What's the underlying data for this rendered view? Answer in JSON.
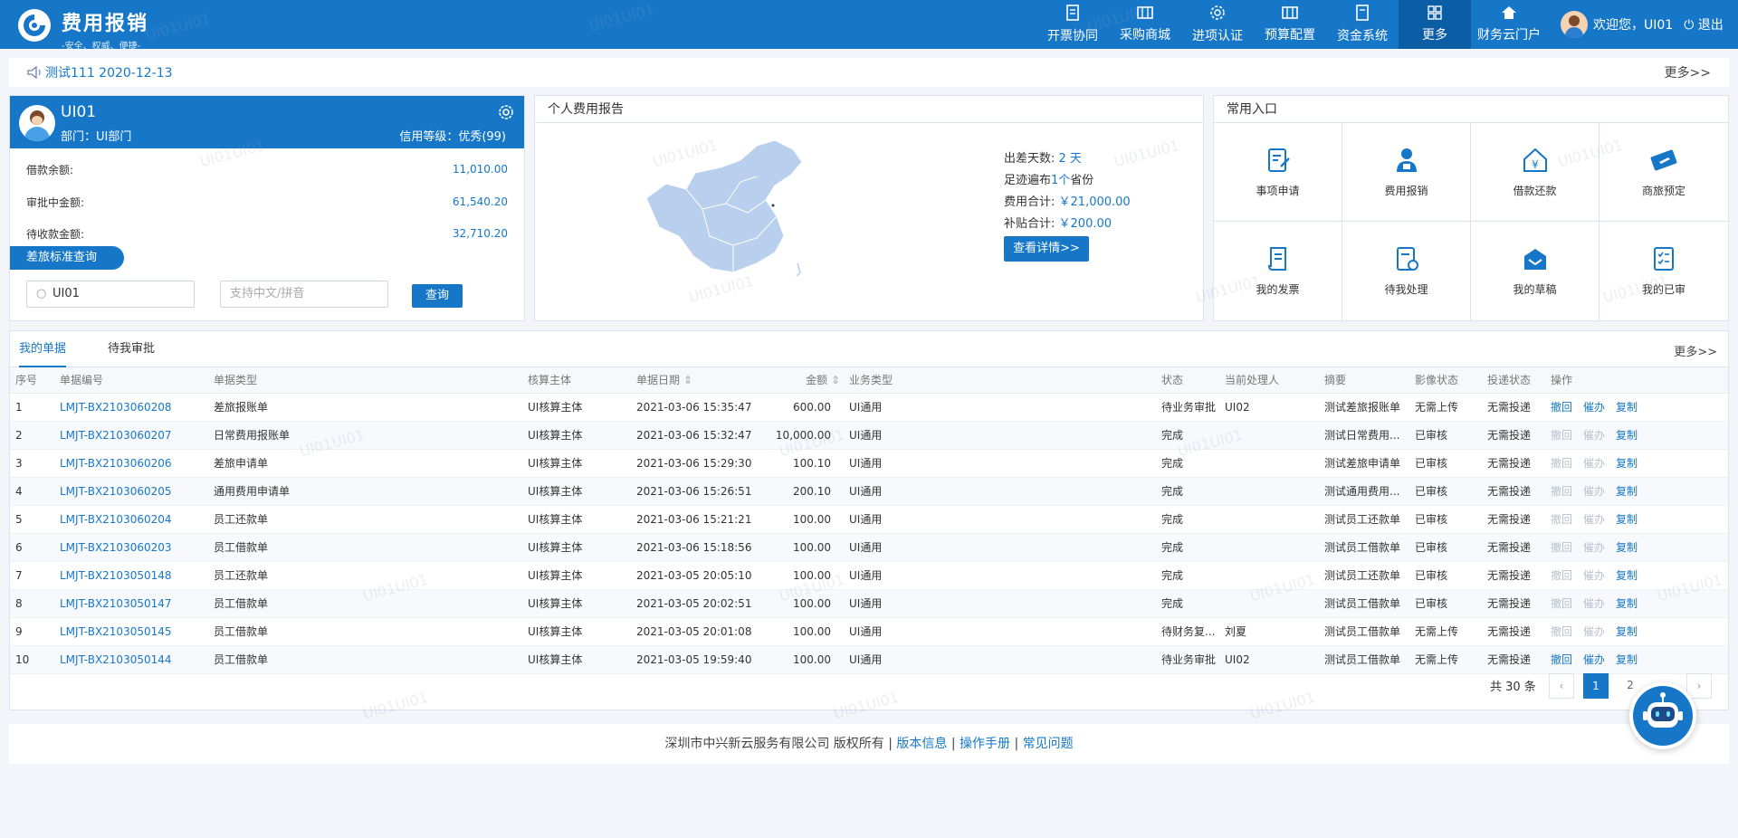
{
  "brand": {
    "title": "费用报销",
    "slogan": "-安全、权威、便捷-"
  },
  "nav": [
    {
      "label": "开票协同",
      "icon": "invoice-icon"
    },
    {
      "label": "采购商城",
      "icon": "mall-icon"
    },
    {
      "label": "进项认证",
      "icon": "certify-icon"
    },
    {
      "label": "预算配置",
      "icon": "budget-icon"
    },
    {
      "label": "资金系统",
      "icon": "fund-icon"
    },
    {
      "label": "更多",
      "icon": "grid-icon"
    },
    {
      "label": "财务云门户",
      "icon": "home-icon"
    }
  ],
  "user": {
    "welcome": "欢迎您，UI01",
    "logout": "退出"
  },
  "notice": {
    "text": "测试111  2020-12-13",
    "more": "更多>>"
  },
  "profile": {
    "name": "UI01",
    "dept": "部门：UI部门",
    "credit": "信用等级：优秀(99)",
    "rows": [
      {
        "label": "借款余额:",
        "value": "11,010.00"
      },
      {
        "label": "审批中金额:",
        "value": "61,540.20"
      },
      {
        "label": "待收款金额:",
        "value": "32,710.20"
      }
    ],
    "travel_btn": "差旅标准查询",
    "search_value": "UI01",
    "search2_placeholder": "支持中文/拼音",
    "query_btn": "查询"
  },
  "report": {
    "title": "个人费用报告",
    "days_label": "出差天数:",
    "days": "2 天",
    "prov_a": "足迹遍布",
    "prov_n": "1个",
    "prov_b": "省份",
    "cost_label": "费用合计:",
    "cost": "￥21,000.00",
    "sub_label": "补贴合计:",
    "sub": "￥200.00",
    "detail_btn": "查看详情>>"
  },
  "entries": {
    "title": "常用入口",
    "items": [
      {
        "label": "事项申请",
        "icon": "edit-doc-icon"
      },
      {
        "label": "费用报销",
        "icon": "person-reimburse-icon"
      },
      {
        "label": "借款还款",
        "icon": "yen-house-icon"
      },
      {
        "label": "商旅预定",
        "icon": "plane-ticket-icon"
      },
      {
        "label": "我的发票",
        "icon": "invoice-scroll-icon"
      },
      {
        "label": "待我处理",
        "icon": "pending-doc-icon"
      },
      {
        "label": "我的草稿",
        "icon": "draft-box-icon"
      },
      {
        "label": "我的已审",
        "icon": "checklist-icon"
      }
    ]
  },
  "docs": {
    "tabs": [
      "我的单据",
      "待我审批"
    ],
    "more": "更多>>",
    "columns": [
      "序号",
      "单据编号",
      "单据类型",
      "核算主体",
      "单据日期",
      "金额",
      "业务类型",
      "状态",
      "当前处理人",
      "摘要",
      "影像状态",
      "投递状态",
      "操作"
    ],
    "ops": [
      "撤回",
      "催办",
      "复制"
    ],
    "rows": [
      {
        "no": "1",
        "code": "LMJT-BX2103060208",
        "type": "差旅报账单",
        "entity": "UI核算主体",
        "date": "2021-03-06 15:35:47",
        "amount": "600.00",
        "biz": "UI通用",
        "status": "待业务审批",
        "handler": "UI02",
        "summary": "测试差旅报账单",
        "image": "无需上传",
        "deliver": "无需投递",
        "active": true
      },
      {
        "no": "2",
        "code": "LMJT-BX2103060207",
        "type": "日常费用报账单",
        "entity": "UI核算主体",
        "date": "2021-03-06 15:32:47",
        "amount": "10,000.00",
        "biz": "UI通用",
        "status": "完成",
        "handler": "",
        "summary": "测试日常费用...",
        "image": "已审核",
        "deliver": "无需投递",
        "active": false
      },
      {
        "no": "3",
        "code": "LMJT-BX2103060206",
        "type": "差旅申请单",
        "entity": "UI核算主体",
        "date": "2021-03-06 15:29:30",
        "amount": "100.10",
        "biz": "UI通用",
        "status": "完成",
        "handler": "",
        "summary": "测试差旅申请单",
        "image": "已审核",
        "deliver": "无需投递",
        "active": false
      },
      {
        "no": "4",
        "code": "LMJT-BX2103060205",
        "type": "通用费用申请单",
        "entity": "UI核算主体",
        "date": "2021-03-06 15:26:51",
        "amount": "200.10",
        "biz": "UI通用",
        "status": "完成",
        "handler": "",
        "summary": "测试通用费用...",
        "image": "已审核",
        "deliver": "无需投递",
        "active": false
      },
      {
        "no": "5",
        "code": "LMJT-BX2103060204",
        "type": "员工还款单",
        "entity": "UI核算主体",
        "date": "2021-03-06 15:21:21",
        "amount": "100.00",
        "biz": "UI通用",
        "status": "完成",
        "handler": "",
        "summary": "测试员工还款单",
        "image": "已审核",
        "deliver": "无需投递",
        "active": false
      },
      {
        "no": "6",
        "code": "LMJT-BX2103060203",
        "type": "员工借款单",
        "entity": "UI核算主体",
        "date": "2021-03-06 15:18:56",
        "amount": "100.00",
        "biz": "UI通用",
        "status": "完成",
        "handler": "",
        "summary": "测试员工借款单",
        "image": "已审核",
        "deliver": "无需投递",
        "active": false
      },
      {
        "no": "7",
        "code": "LMJT-BX2103050148",
        "type": "员工还款单",
        "entity": "UI核算主体",
        "date": "2021-03-05 20:05:10",
        "amount": "100.00",
        "biz": "UI通用",
        "status": "完成",
        "handler": "",
        "summary": "测试员工还款单",
        "image": "已审核",
        "deliver": "无需投递",
        "active": false
      },
      {
        "no": "8",
        "code": "LMJT-BX2103050147",
        "type": "员工借款单",
        "entity": "UI核算主体",
        "date": "2021-03-05 20:02:51",
        "amount": "100.00",
        "biz": "UI通用",
        "status": "完成",
        "handler": "",
        "summary": "测试员工借款单",
        "image": "已审核",
        "deliver": "无需投递",
        "active": false
      },
      {
        "no": "9",
        "code": "LMJT-BX2103050145",
        "type": "员工借款单",
        "entity": "UI核算主体",
        "date": "2021-03-05 20:01:08",
        "amount": "100.00",
        "biz": "UI通用",
        "status": "待财务复...",
        "handler": "刘夏",
        "summary": "测试员工借款单",
        "image": "无需上传",
        "deliver": "无需投递",
        "active": false
      },
      {
        "no": "10",
        "code": "LMJT-BX2103050144",
        "type": "员工借款单",
        "entity": "UI核算主体",
        "date": "2021-03-05 19:59:40",
        "amount": "100.00",
        "biz": "UI通用",
        "status": "待业务审批",
        "handler": "UI02",
        "summary": "测试员工借款单",
        "image": "无需上传",
        "deliver": "无需投递",
        "active": true
      }
    ],
    "total": "共 30 条",
    "pages": [
      "1",
      "2"
    ],
    "current_page": "1"
  },
  "footer": {
    "copyright": "深圳市中兴新云服务有限公司 版权所有 |",
    "links": [
      "版本信息",
      "操作手册",
      "常见问题"
    ]
  },
  "watermark": "UI01UI01",
  "colors": {
    "primary": "#1677c9",
    "nav_active": "#0b5da6",
    "disabled": "#b8c0cc"
  }
}
